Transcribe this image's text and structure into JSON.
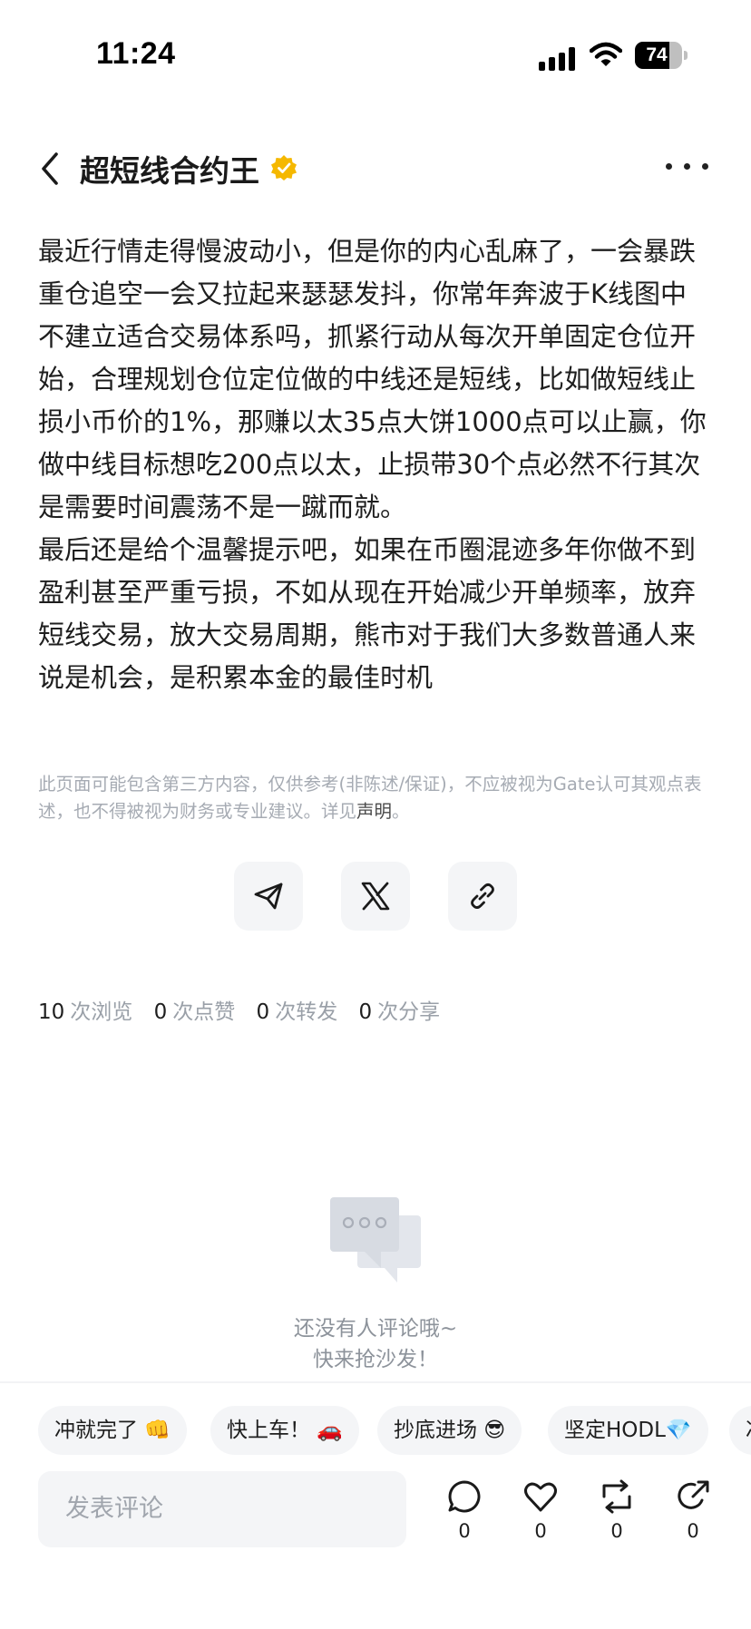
{
  "status_bar": {
    "time": "11:24",
    "battery_pct": "74",
    "battery_level": 0.74
  },
  "header": {
    "author_name": "超短线合约王",
    "verified": true
  },
  "article": {
    "paragraphs": [
      "最近行情走得慢波动小，但是你的内心乱麻了，一会暴跌重仓追空一会又拉起来瑟瑟发抖，你常年奔波于K线图中不建立适合交易体系吗，抓紧行动从每次开单固定仓位开始，合理规划仓位定位做的中线还是短线，比如做短线止损小币价的1%，那赚以太35点大饼1000点可以止赢，你做中线目标想吃200点以太，止损带30个点必然不行其次是需要时间震荡不是一蹴而就。",
      "最后还是给个温馨提示吧，如果在币圈混迹多年你做不到盈利甚至严重亏损，不如从现在开始减少开单频率，放弃短线交易，放大交易周期，熊市对于我们大多数普通人来说是机会，是积累本金的最佳时机"
    ]
  },
  "disclaimer": {
    "text": "此页面可能包含第三方内容，仅供参考(非陈述/保证)，不应被视为Gate认可其观点表述，也不得被视为财务或专业建议。详见",
    "link": "声明",
    "end": "。"
  },
  "share": {
    "icons": [
      "send-icon",
      "x-logo-icon",
      "link-icon"
    ]
  },
  "stats": {
    "views": "10",
    "views_label": "次浏览",
    "likes": "0",
    "likes_label": "次点赞",
    "reposts": "0",
    "reposts_label": "次转发",
    "shares": "0",
    "shares_label": "次分享"
  },
  "comments_empty": {
    "line1": "还没有人评论哦~",
    "line2": "快来抢沙发！"
  },
  "quick_replies": [
    "冲就完了 👊",
    "快上车！ 🚗",
    "抄底进场 😎",
    "坚定HODL💎",
    "冲"
  ],
  "bottom_bar": {
    "comment_placeholder": "发表评论",
    "comment_count": "0",
    "like_count": "0",
    "repost_count": "0",
    "share_count": "0"
  },
  "colors": {
    "muted": "#9aa0a8",
    "chip_bg": "#f4f5f7",
    "verified": "#f5b800"
  }
}
